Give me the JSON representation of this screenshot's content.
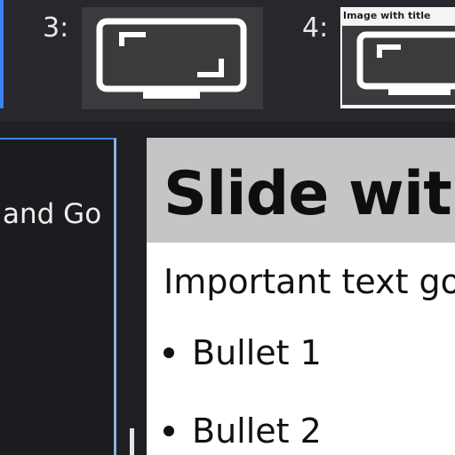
{
  "thumbnails": [
    {
      "number": "3:",
      "title": ""
    },
    {
      "number": "4:",
      "title": "Image with title"
    }
  ],
  "left_panel": {
    "text": "and Go"
  },
  "slide": {
    "title": "Slide with",
    "body": "Important text go",
    "bullets": [
      "Bullet 1",
      "Bullet 2"
    ]
  },
  "colors": {
    "selection": "#3b82f6",
    "slide_title_band": "#c5c5c5",
    "thumb_image_bg": "#3a3b3d"
  }
}
